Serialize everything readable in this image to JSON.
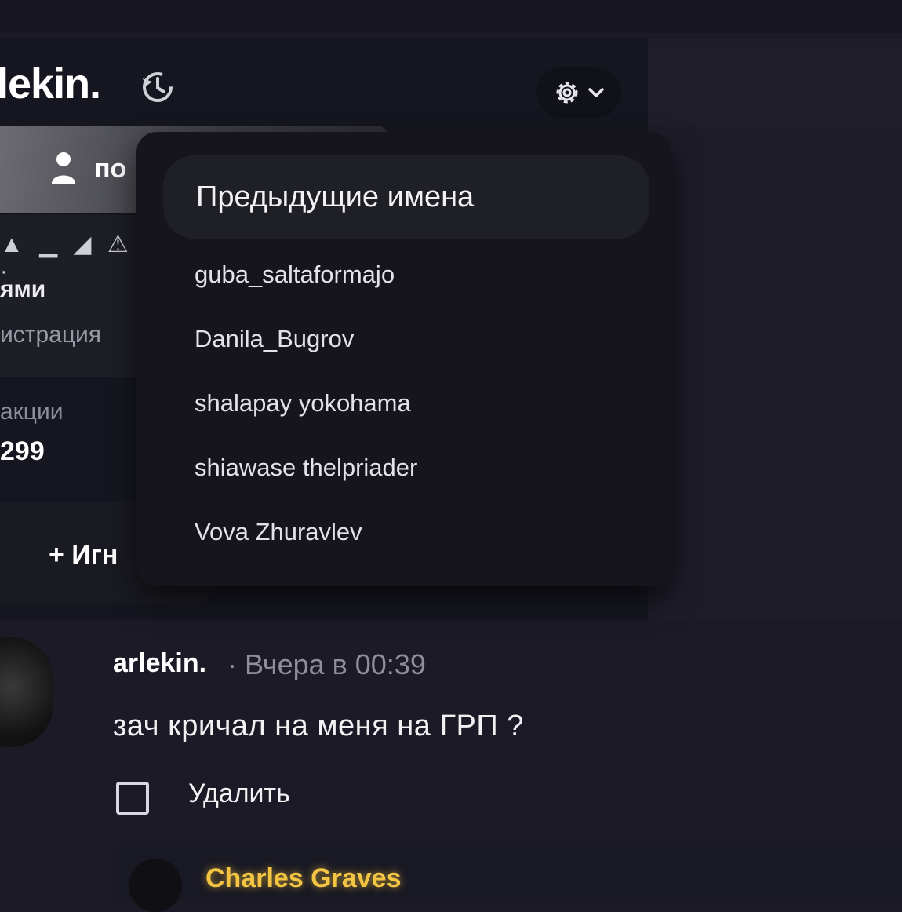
{
  "profile": {
    "username": "lekin.",
    "banner_label": "по",
    "badges": "▲ ▁ ◢ ⚠ ·",
    "stat_label_1": "ями",
    "stat_label_2": "истрация",
    "stat_label_3": "акции",
    "stat_value_3": "299",
    "ignore_label": "+ Игн"
  },
  "dropdown": {
    "title": "Предыдущие имена",
    "names": [
      "guba_saltaformajo",
      "Danila_Bugrov",
      "shalapay yokohama",
      "shiawase thelpriader",
      "Vova Zhuravlev"
    ]
  },
  "post": {
    "author": "arlekin.",
    "time": "· Вчера в 00:39",
    "text": "зач кричал на меня на ГРП ?",
    "delete_label": "Удалить"
  },
  "comment": {
    "author": "Charles Graves"
  },
  "colors": {
    "highlight_name": "#f4c542",
    "panel_bg": "#161620",
    "page_bg": "#1b1a26"
  },
  "icons": {
    "history": "history-icon",
    "settings": "gear-icon",
    "chevron": "chevron-down-icon",
    "user": "user-icon"
  }
}
